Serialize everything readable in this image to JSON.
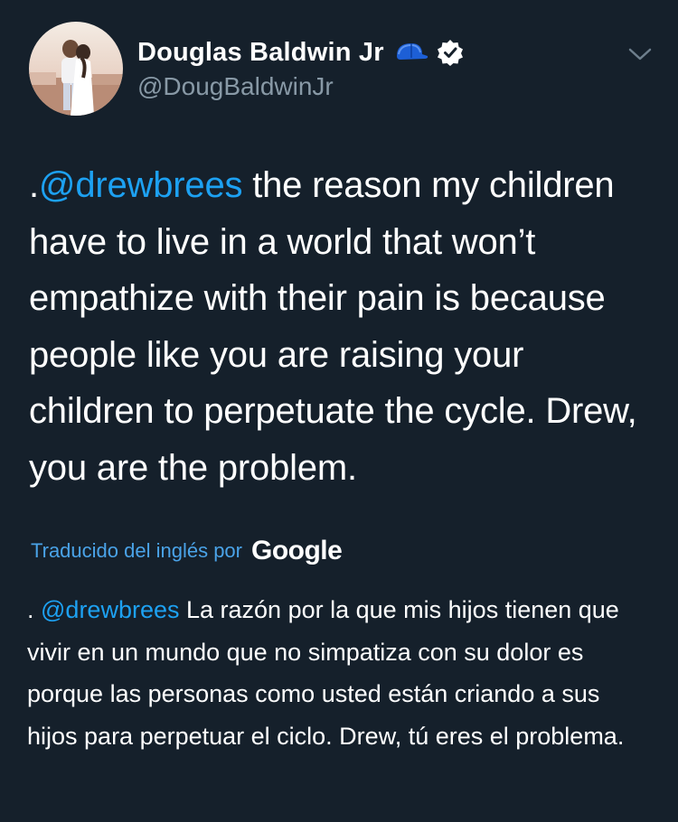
{
  "user": {
    "display_name": "Douglas Baldwin Jr",
    "handle": "@DougBaldwinJr",
    "icons": [
      "avatar-photo",
      "cap-icon",
      "verified-icon"
    ]
  },
  "menu": {
    "icon": "chevron-down-icon"
  },
  "tweet": {
    "prefix": ".",
    "mention": "@drewbrees",
    "body": " the reason my children have to live in a world that won’t empathize with their pain is because people like you are raising your children to perpetuate the cycle. Drew, you are the problem."
  },
  "translation": {
    "label": "Traducido del inglés por",
    "provider": "Google",
    "prefix": ". ",
    "mention": "@drewbrees",
    "body": " La razón por la que mis hijos tienen que vivir en un mundo que no simpatiza con su dolor es porque las personas como usted están criando a sus hijos para perpetuar el ciclo. Drew, tú eres el problema."
  },
  "colors": {
    "background": "#15202b",
    "link": "#1da1f2",
    "secondary_text": "#8899a6",
    "translation_label": "#4aa3e8"
  }
}
